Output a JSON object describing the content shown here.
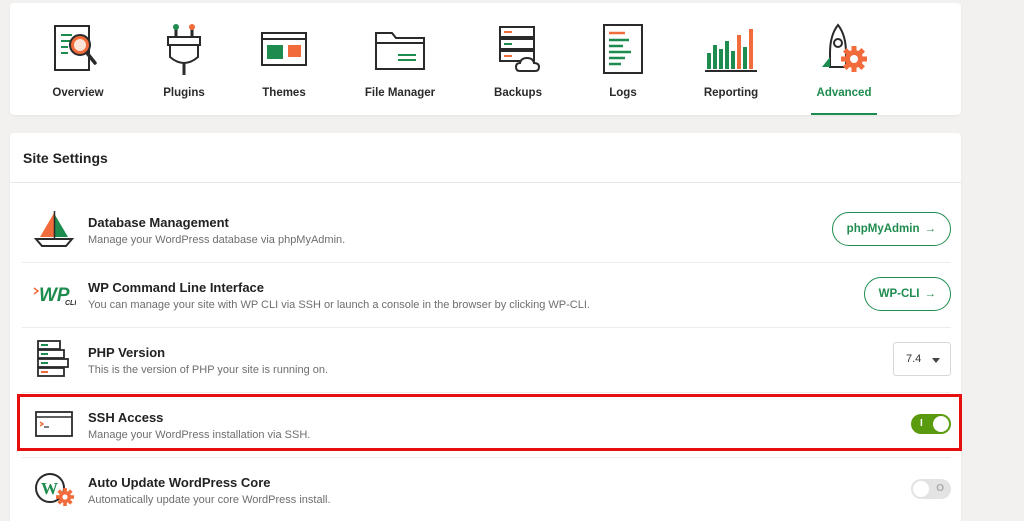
{
  "nav": {
    "items": [
      {
        "label": "Overview",
        "icon": "magnifier-document-icon"
      },
      {
        "label": "Plugins",
        "icon": "plug-icon"
      },
      {
        "label": "Themes",
        "icon": "theme-window-icon"
      },
      {
        "label": "File Manager",
        "icon": "folder-icon"
      },
      {
        "label": "Backups",
        "icon": "server-cloud-icon"
      },
      {
        "label": "Logs",
        "icon": "log-document-icon"
      },
      {
        "label": "Reporting",
        "icon": "bar-chart-icon"
      },
      {
        "label": "Advanced",
        "icon": "rocket-gear-icon"
      }
    ],
    "active": "Advanced"
  },
  "settings": {
    "title": "Site Settings",
    "rows": [
      {
        "title": "Database Management",
        "desc": "Manage your WordPress database via phpMyAdmin.",
        "button": "phpMyAdmin",
        "icon": "sailboat-icon"
      },
      {
        "title": "WP Command Line Interface",
        "desc": "You can manage your site with WP CLI via SSH or launch a console in the browser by clicking WP-CLI.",
        "button": "WP-CLI",
        "icon": "wp-cli-logo"
      },
      {
        "title": "PHP Version",
        "desc": "This is the version of PHP your site is running on.",
        "select_value": "7.4",
        "icon": "server-stack-icon"
      },
      {
        "title": "SSH Access",
        "desc": "Manage your WordPress installation via SSH.",
        "toggle": "on",
        "icon": "terminal-window-icon"
      },
      {
        "title": "Auto Update WordPress Core",
        "desc": "Automatically update your core WordPress install.",
        "toggle": "off",
        "icon": "wordpress-gear-icon"
      }
    ],
    "arrow": "→",
    "toggle_on_mark": "I",
    "toggle_off_mark": "O"
  },
  "colors": {
    "accent": "#1e8c4e",
    "orange": "#f26b3a",
    "toggle_on": "#5a9a0f",
    "highlight": "#e60f0f"
  }
}
